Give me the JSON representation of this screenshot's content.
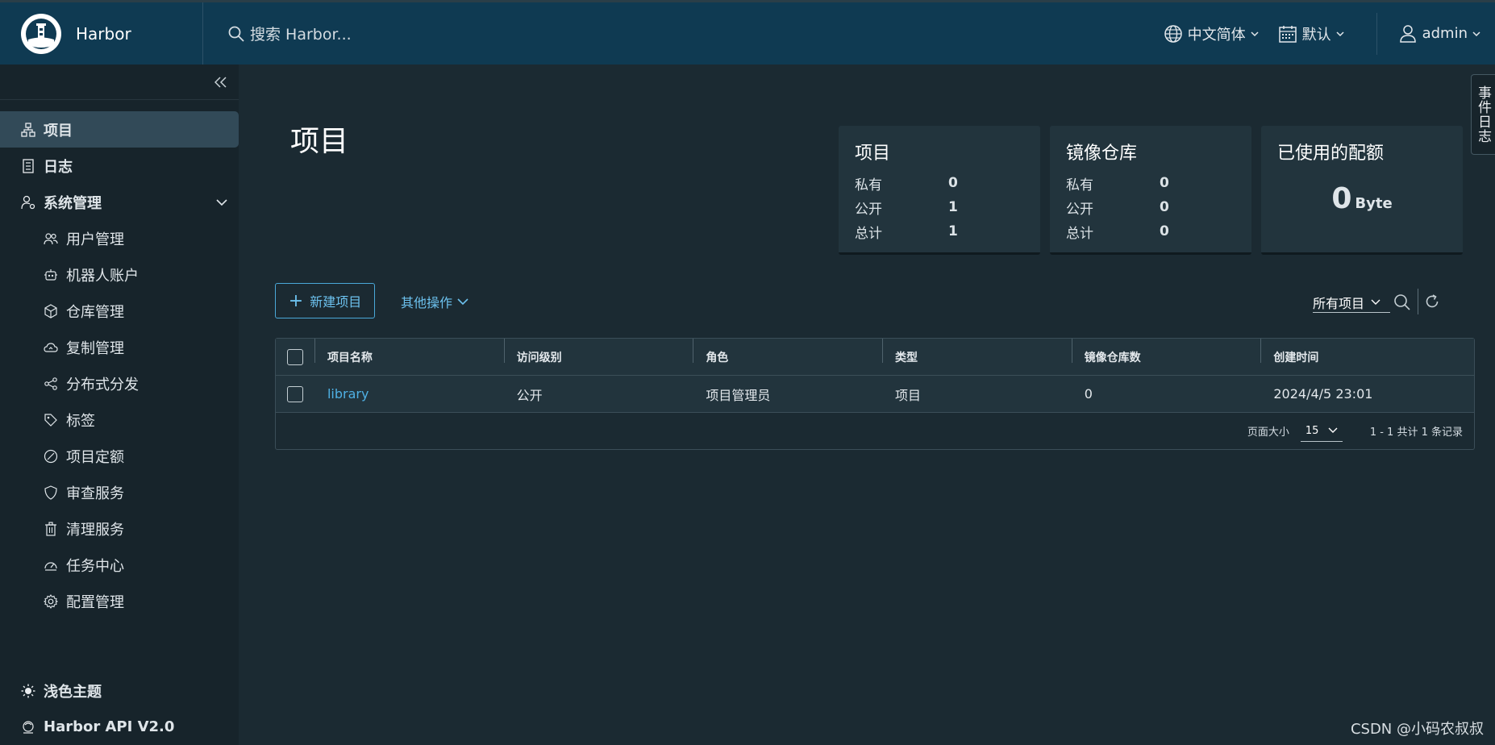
{
  "header": {
    "app_name": "Harbor",
    "search_placeholder": "搜索 Harbor...",
    "language": "中文简体",
    "date_format": "默认",
    "user": "admin"
  },
  "sidebar": {
    "items": [
      {
        "label": "项目",
        "icon": "projects-icon"
      },
      {
        "label": "日志",
        "icon": "logs-icon"
      },
      {
        "label": "系统管理",
        "icon": "admin-icon"
      }
    ],
    "admin_items": [
      {
        "label": "用户管理",
        "icon": "users-icon"
      },
      {
        "label": "机器人账户",
        "icon": "robot-icon"
      },
      {
        "label": "仓库管理",
        "icon": "registry-icon"
      },
      {
        "label": "复制管理",
        "icon": "replication-icon"
      },
      {
        "label": "分布式分发",
        "icon": "share-icon"
      },
      {
        "label": "标签",
        "icon": "tag-icon"
      },
      {
        "label": "项目定额",
        "icon": "quota-icon"
      },
      {
        "label": "审查服务",
        "icon": "shield-icon"
      },
      {
        "label": "清理服务",
        "icon": "trash-icon"
      },
      {
        "label": "任务中心",
        "icon": "dashboard-icon"
      },
      {
        "label": "配置管理",
        "icon": "gear-icon"
      }
    ],
    "bottom": {
      "theme": "浅色主题",
      "api": "Harbor API V2.0"
    }
  },
  "event_log_tab": "事件日志",
  "main": {
    "title": "项目",
    "cards": {
      "projects": {
        "title": "项目",
        "private_label": "私有",
        "private": "0",
        "public_label": "公开",
        "public": "1",
        "total_label": "总计",
        "total": "1"
      },
      "repositories": {
        "title": "镜像仓库",
        "private_label": "私有",
        "private": "0",
        "public_label": "公开",
        "public": "0",
        "total_label": "总计",
        "total": "0"
      },
      "quota": {
        "title": "已使用的配额",
        "value": "0",
        "unit": "Byte"
      }
    },
    "new_project": "新建项目",
    "other_actions": "其他操作",
    "filter_value": "所有项目",
    "table": {
      "headers": [
        "项目名称",
        "访问级别",
        "角色",
        "类型",
        "镜像仓库数",
        "创建时间"
      ],
      "rows": [
        {
          "name": "library",
          "access": "公开",
          "role": "项目管理员",
          "type": "项目",
          "repo_count": "0",
          "created": "2024/4/5 23:01"
        }
      ],
      "page_size_label": "页面大小",
      "page_size": "15",
      "pager_info": "1 - 1 共计 1 条记录"
    }
  },
  "watermark": "CSDN @小码农叔叔",
  "colors": {
    "header_bg": "#0f3a52",
    "sidebar_bg": "#17242b",
    "main_bg": "#1b2a32",
    "accent": "#4fb0e4"
  }
}
